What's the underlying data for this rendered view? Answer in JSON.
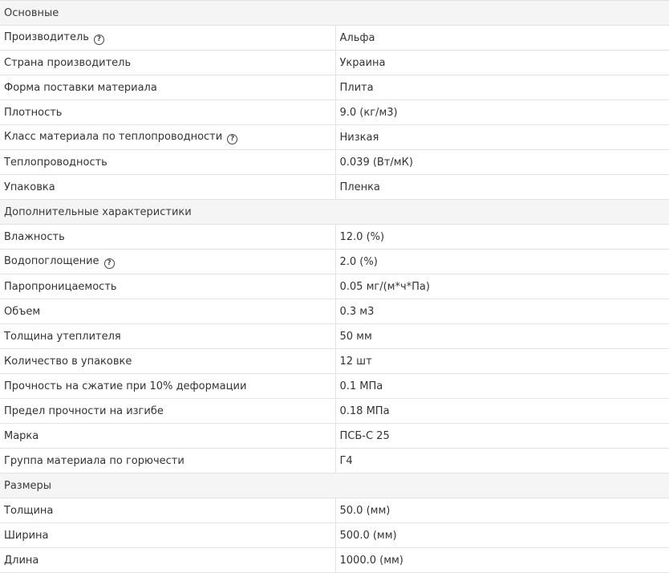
{
  "help_glyph": "?",
  "sections": [
    {
      "title": "Основные",
      "rows": [
        {
          "label": "Производитель",
          "value": "Альфа",
          "help": true
        },
        {
          "label": "Страна производитель",
          "value": "Украина"
        },
        {
          "label": "Форма поставки материала",
          "value": "Плита"
        },
        {
          "label": "Плотность",
          "value": "9.0 (кг/м3)"
        },
        {
          "label": "Класс материала по теплопроводности",
          "value": "Низкая",
          "help": true
        },
        {
          "label": "Теплопроводность",
          "value": "0.039 (Вт/мК)"
        },
        {
          "label": "Упаковка",
          "value": "Пленка"
        }
      ]
    },
    {
      "title": "Дополнительные характеристики",
      "rows": [
        {
          "label": "Влажность",
          "value": "12.0 (%)"
        },
        {
          "label": "Водопоглощение",
          "value": "2.0 (%)",
          "help": true
        },
        {
          "label": "Паропроницаемость",
          "value": "0.05 мг/(м*ч*Па)"
        },
        {
          "label": "Объем",
          "value": "0.3 м3"
        },
        {
          "label": "Толщина утеплителя",
          "value": "50 мм"
        },
        {
          "label": "Количество в упаковке",
          "value": "12 шт"
        },
        {
          "label": "Прочность на сжатие при 10% деформации",
          "value": "0.1 МПа"
        },
        {
          "label": "Предел прочности на изгибе",
          "value": "0.18 МПа"
        },
        {
          "label": "Марка",
          "value": "ПСБ-С 25"
        },
        {
          "label": "Группа материала по горючести",
          "value": "Г4"
        }
      ]
    },
    {
      "title": "Размеры",
      "rows": [
        {
          "label": "Толщина",
          "value": "50.0 (мм)"
        },
        {
          "label": "Ширина",
          "value": "500.0 (мм)"
        },
        {
          "label": "Длина",
          "value": "1000.0 (мм)"
        }
      ]
    }
  ]
}
